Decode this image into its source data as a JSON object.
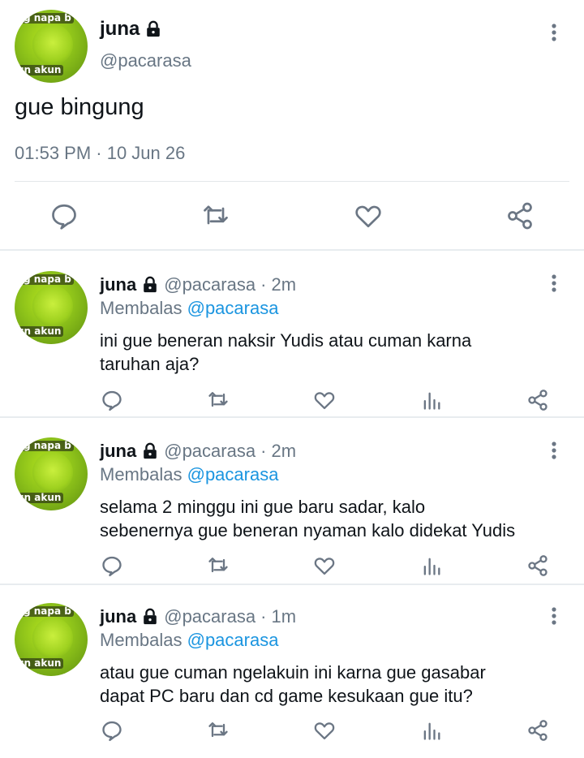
{
  "main_tweet": {
    "display_name": "juna",
    "handle": "@pacarasa",
    "text": "gue bingung",
    "timestamp": "01:53 PM · 10 Jun 26",
    "avatar_text": [
      "g napa b",
      "un akun"
    ]
  },
  "replies": [
    {
      "display_name": "juna",
      "handle": "@pacarasa",
      "time": "· 2m",
      "replying_label": "Membalas",
      "replying_to": "@pacarasa",
      "text": "ini gue beneran naksir Yudis atau cuman karna\ntaruhan aja?"
    },
    {
      "display_name": "juna",
      "handle": "@pacarasa",
      "time": "· 2m",
      "replying_label": "Membalas",
      "replying_to": "@pacarasa",
      "text": "selama 2 minggu ini gue baru sadar, kalo\nsebenernya gue beneran nyaman kalo didekat Yudis"
    },
    {
      "display_name": "juna",
      "handle": "@pacarasa",
      "time": "· 1m",
      "replying_label": "Membalas",
      "replying_to": "@pacarasa",
      "text": "atau gue cuman ngelakuin ini karna gue gasabar\ndapat PC baru dan cd game kesukaan gue itu?"
    }
  ],
  "icons": {
    "lock": "lock-icon",
    "more": "more-vertical-icon",
    "reply": "comment-icon",
    "retweet": "retweet-icon",
    "like": "heart-icon",
    "analytics": "analytics-icon",
    "share": "share-icon"
  },
  "colors": {
    "text": "#0f1419",
    "muted": "#687684",
    "mention": "#1b95e0",
    "divider": "#e8ecef",
    "avatar_green": "#9ed11f"
  }
}
